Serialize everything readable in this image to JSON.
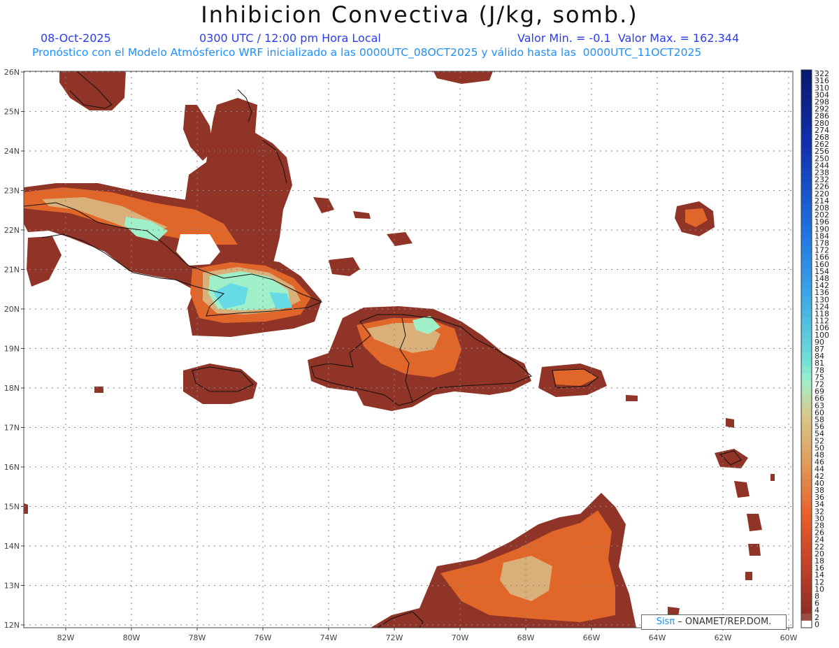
{
  "header": {
    "title": "Inhibicion Convectiva (J/kg, somb.)",
    "date": "08-Oct-2025",
    "time": "0300 UTC / 12:00 pm Hora Local",
    "range": "Valor Min. = -0.1  Valor Max. = 162.344",
    "model_info": "Pronóstico con el Modelo Atmósferico WRF inicializado a las 0000UTC_08OCT2025 y válido hasta las  0000UTC_11OCT2025"
  },
  "credit": {
    "brand": "Sisπ",
    "text": " – ONAMET/REP.DOM."
  },
  "axes": {
    "lat_labels": [
      "26N",
      "25N",
      "24N",
      "23N",
      "22N",
      "21N",
      "20N",
      "19N",
      "18N",
      "17N",
      "16N",
      "15N",
      "14N",
      "13N",
      "12N"
    ],
    "lon_labels": [
      "82W",
      "80W",
      "78W",
      "76W",
      "74W",
      "72W",
      "70W",
      "68W",
      "66W",
      "64W",
      "62W",
      "60W"
    ]
  },
  "colorbar": {
    "labels": [
      "322",
      "316",
      "310",
      "304",
      "298",
      "292",
      "286",
      "280",
      "274",
      "268",
      "262",
      "256",
      "250",
      "244",
      "238",
      "232",
      "226",
      "220",
      "214",
      "208",
      "202",
      "196",
      "190",
      "184",
      "178",
      "172",
      "166",
      "160",
      "154",
      "148",
      "142",
      "136",
      "130",
      "124",
      "118",
      "112",
      "106",
      "100",
      "90",
      "87",
      "84",
      "81",
      "78",
      "75",
      "72",
      "69",
      "66",
      "63",
      "60",
      "58",
      "56",
      "54",
      "52",
      "50",
      "48",
      "46",
      "44",
      "42",
      "40",
      "38",
      "36",
      "34",
      "32",
      "30",
      "28",
      "26",
      "24",
      "22",
      "20",
      "18",
      "16",
      "14",
      "12",
      "10",
      "8",
      "6",
      "4",
      "2",
      "0"
    ]
  },
  "colors": {
    "base": "#8f3426",
    "orange": "#e0662a",
    "tan": "#d9b07a",
    "mint": "#9ff0c8",
    "cyan": "#66dbe6",
    "sea": "#ffffff"
  }
}
